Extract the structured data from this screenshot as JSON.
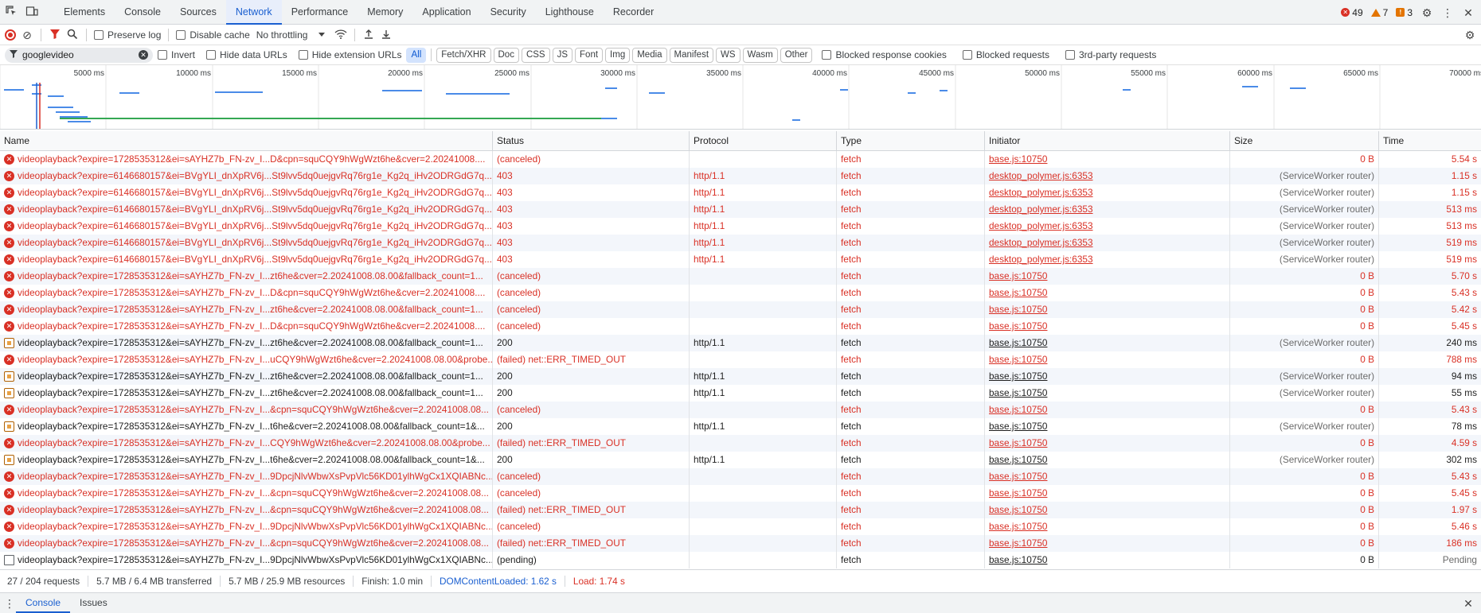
{
  "tabbar": {
    "tabs": [
      {
        "label": "Elements",
        "active": false
      },
      {
        "label": "Console",
        "active": false
      },
      {
        "label": "Sources",
        "active": false
      },
      {
        "label": "Network",
        "active": true
      },
      {
        "label": "Performance",
        "active": false
      },
      {
        "label": "Memory",
        "active": false
      },
      {
        "label": "Application",
        "active": false
      },
      {
        "label": "Security",
        "active": false
      },
      {
        "label": "Lighthouse",
        "active": false
      },
      {
        "label": "Recorder",
        "active": false
      }
    ],
    "errors": "49",
    "warnings": "7",
    "issues": "3"
  },
  "toolbar": {
    "preserve_log": "Preserve log",
    "disable_cache": "Disable cache",
    "throttling": "No throttling"
  },
  "filter": {
    "value": "googlevideo",
    "invert": "Invert",
    "hide_data_urls": "Hide data URLs",
    "hide_extension_urls": "Hide extension URLs",
    "types": [
      "All",
      "Fetch/XHR",
      "Doc",
      "CSS",
      "JS",
      "Font",
      "Img",
      "Media",
      "Manifest",
      "WS",
      "Wasm",
      "Other"
    ],
    "active_type": "All",
    "blocked_cookies": "Blocked response cookies",
    "blocked_requests": "Blocked requests",
    "third_party": "3rd-party requests"
  },
  "overview": {
    "ticks": [
      "5000 ms",
      "10000 ms",
      "15000 ms",
      "20000 ms",
      "25000 ms",
      "30000 ms",
      "35000 ms",
      "40000 ms",
      "45000 ms",
      "50000 ms",
      "55000 ms",
      "60000 ms",
      "65000 ms",
      "70000 ms"
    ],
    "colors": {
      "bar": "#4a8be8",
      "green": "#34a853",
      "domcontent": "#1a5fd0",
      "load": "#d93025"
    }
  },
  "table": {
    "headers": {
      "name": "Name",
      "status": "Status",
      "protocol": "Protocol",
      "type": "Type",
      "initiator": "Initiator",
      "size": "Size",
      "time": "Time"
    },
    "rows": [
      {
        "kind": "err",
        "name": "videoplayback?expire=1728535312&ei=sAYHZ7b_FN-zv_I...D&cpn=squCQY9hWgWzt6he&cver=2.20241008....",
        "status": "(canceled)",
        "protocol": "",
        "type": "fetch",
        "initiator": "base.js:10750",
        "size": "0 B",
        "time": "5.54 s"
      },
      {
        "kind": "err",
        "name": "videoplayback?expire=6146680157&ei=BVgYLI_dnXpRV6j...St9lvv5dq0uejgvRq76rg1e_Kg2q_iHv2ODRGdG7q...",
        "status": "403",
        "protocol": "http/1.1",
        "type": "fetch",
        "initiator": "desktop_polymer.js:6353",
        "size": "(ServiceWorker router)",
        "time": "1.15 s"
      },
      {
        "kind": "err",
        "name": "videoplayback?expire=6146680157&ei=BVgYLI_dnXpRV6j...St9lvv5dq0uejgvRq76rg1e_Kg2q_iHv2ODRGdG7q...",
        "status": "403",
        "protocol": "http/1.1",
        "type": "fetch",
        "initiator": "desktop_polymer.js:6353",
        "size": "(ServiceWorker router)",
        "time": "1.15 s"
      },
      {
        "kind": "err",
        "name": "videoplayback?expire=6146680157&ei=BVgYLI_dnXpRV6j...St9lvv5dq0uejgvRq76rg1e_Kg2q_iHv2ODRGdG7q...",
        "status": "403",
        "protocol": "http/1.1",
        "type": "fetch",
        "initiator": "desktop_polymer.js:6353",
        "size": "(ServiceWorker router)",
        "time": "513 ms"
      },
      {
        "kind": "err",
        "name": "videoplayback?expire=6146680157&ei=BVgYLI_dnXpRV6j...St9lvv5dq0uejgvRq76rg1e_Kg2q_iHv2ODRGdG7q...",
        "status": "403",
        "protocol": "http/1.1",
        "type": "fetch",
        "initiator": "desktop_polymer.js:6353",
        "size": "(ServiceWorker router)",
        "time": "513 ms"
      },
      {
        "kind": "err",
        "name": "videoplayback?expire=6146680157&ei=BVgYLI_dnXpRV6j...St9lvv5dq0uejgvRq76rg1e_Kg2q_iHv2ODRGdG7q...",
        "status": "403",
        "protocol": "http/1.1",
        "type": "fetch",
        "initiator": "desktop_polymer.js:6353",
        "size": "(ServiceWorker router)",
        "time": "519 ms"
      },
      {
        "kind": "err",
        "name": "videoplayback?expire=6146680157&ei=BVgYLI_dnXpRV6j...St9lvv5dq0uejgvRq76rg1e_Kg2q_iHv2ODRGdG7q...",
        "status": "403",
        "protocol": "http/1.1",
        "type": "fetch",
        "initiator": "desktop_polymer.js:6353",
        "size": "(ServiceWorker router)",
        "time": "519 ms"
      },
      {
        "kind": "err",
        "name": "videoplayback?expire=1728535312&ei=sAYHZ7b_FN-zv_I...zt6he&cver=2.20241008.08.00&fallback_count=1...",
        "status": "(canceled)",
        "protocol": "",
        "type": "fetch",
        "initiator": "base.js:10750",
        "size": "0 B",
        "time": "5.70 s"
      },
      {
        "kind": "err",
        "name": "videoplayback?expire=1728535312&ei=sAYHZ7b_FN-zv_I...D&cpn=squCQY9hWgWzt6he&cver=2.20241008....",
        "status": "(canceled)",
        "protocol": "",
        "type": "fetch",
        "initiator": "base.js:10750",
        "size": "0 B",
        "time": "5.43 s"
      },
      {
        "kind": "err",
        "name": "videoplayback?expire=1728535312&ei=sAYHZ7b_FN-zv_I...zt6he&cver=2.20241008.08.00&fallback_count=1...",
        "status": "(canceled)",
        "protocol": "",
        "type": "fetch",
        "initiator": "base.js:10750",
        "size": "0 B",
        "time": "5.42 s"
      },
      {
        "kind": "err",
        "name": "videoplayback?expire=1728535312&ei=sAYHZ7b_FN-zv_I...D&cpn=squCQY9hWgWzt6he&cver=2.20241008....",
        "status": "(canceled)",
        "protocol": "",
        "type": "fetch",
        "initiator": "base.js:10750",
        "size": "0 B",
        "time": "5.45 s"
      },
      {
        "kind": "ok",
        "name": "videoplayback?expire=1728535312&ei=sAYHZ7b_FN-zv_I...zt6he&cver=2.20241008.08.00&fallback_count=1...",
        "status": "200",
        "protocol": "http/1.1",
        "type": "fetch",
        "initiator": "base.js:10750",
        "size": "(ServiceWorker router)",
        "time": "240 ms"
      },
      {
        "kind": "err",
        "name": "videoplayback?expire=1728535312&ei=sAYHZ7b_FN-zv_I...uCQY9hWgWzt6he&cver=2.20241008.08.00&probe...",
        "status": "(failed) net::ERR_TIMED_OUT",
        "protocol": "",
        "type": "fetch",
        "initiator": "base.js:10750",
        "size": "0 B",
        "time": "788 ms"
      },
      {
        "kind": "ok",
        "name": "videoplayback?expire=1728535312&ei=sAYHZ7b_FN-zv_I...zt6he&cver=2.20241008.08.00&fallback_count=1...",
        "status": "200",
        "protocol": "http/1.1",
        "type": "fetch",
        "initiator": "base.js:10750",
        "size": "(ServiceWorker router)",
        "time": "94 ms"
      },
      {
        "kind": "ok",
        "name": "videoplayback?expire=1728535312&ei=sAYHZ7b_FN-zv_I...zt6he&cver=2.20241008.08.00&fallback_count=1...",
        "status": "200",
        "protocol": "http/1.1",
        "type": "fetch",
        "initiator": "base.js:10750",
        "size": "(ServiceWorker router)",
        "time": "55 ms"
      },
      {
        "kind": "err",
        "name": "videoplayback?expire=1728535312&ei=sAYHZ7b_FN-zv_I...&cpn=squCQY9hWgWzt6he&cver=2.20241008.08...",
        "status": "(canceled)",
        "protocol": "",
        "type": "fetch",
        "initiator": "base.js:10750",
        "size": "0 B",
        "time": "5.43 s"
      },
      {
        "kind": "ok",
        "name": "videoplayback?expire=1728535312&ei=sAYHZ7b_FN-zv_I...t6he&cver=2.20241008.08.00&fallback_count=1&...",
        "status": "200",
        "protocol": "http/1.1",
        "type": "fetch",
        "initiator": "base.js:10750",
        "size": "(ServiceWorker router)",
        "time": "78 ms"
      },
      {
        "kind": "err",
        "name": "videoplayback?expire=1728535312&ei=sAYHZ7b_FN-zv_I...CQY9hWgWzt6he&cver=2.20241008.08.00&probe...",
        "status": "(failed) net::ERR_TIMED_OUT",
        "protocol": "",
        "type": "fetch",
        "initiator": "base.js:10750",
        "size": "0 B",
        "time": "4.59 s"
      },
      {
        "kind": "ok",
        "name": "videoplayback?expire=1728535312&ei=sAYHZ7b_FN-zv_I...t6he&cver=2.20241008.08.00&fallback_count=1&...",
        "status": "200",
        "protocol": "http/1.1",
        "type": "fetch",
        "initiator": "base.js:10750",
        "size": "(ServiceWorker router)",
        "time": "302 ms"
      },
      {
        "kind": "err",
        "name": "videoplayback?expire=1728535312&ei=sAYHZ7b_FN-zv_I...9DpcjNlvWbwXsPvpVlc56KD01ylhWgCx1XQIABNc...",
        "status": "(canceled)",
        "protocol": "",
        "type": "fetch",
        "initiator": "base.js:10750",
        "size": "0 B",
        "time": "5.43 s"
      },
      {
        "kind": "err",
        "name": "videoplayback?expire=1728535312&ei=sAYHZ7b_FN-zv_I...&cpn=squCQY9hWgWzt6he&cver=2.20241008.08...",
        "status": "(canceled)",
        "protocol": "",
        "type": "fetch",
        "initiator": "base.js:10750",
        "size": "0 B",
        "time": "5.45 s"
      },
      {
        "kind": "err",
        "name": "videoplayback?expire=1728535312&ei=sAYHZ7b_FN-zv_I...&cpn=squCQY9hWgWzt6he&cver=2.20241008.08...",
        "status": "(failed) net::ERR_TIMED_OUT",
        "protocol": "",
        "type": "fetch",
        "initiator": "base.js:10750",
        "size": "0 B",
        "time": "1.97 s"
      },
      {
        "kind": "err",
        "name": "videoplayback?expire=1728535312&ei=sAYHZ7b_FN-zv_I...9DpcjNlvWbwXsPvpVlc56KD01ylhWgCx1XQIABNc...",
        "status": "(canceled)",
        "protocol": "",
        "type": "fetch",
        "initiator": "base.js:10750",
        "size": "0 B",
        "time": "5.46 s"
      },
      {
        "kind": "err",
        "name": "videoplayback?expire=1728535312&ei=sAYHZ7b_FN-zv_I...&cpn=squCQY9hWgWzt6he&cver=2.20241008.08...",
        "status": "(failed) net::ERR_TIMED_OUT",
        "protocol": "",
        "type": "fetch",
        "initiator": "base.js:10750",
        "size": "0 B",
        "time": "186 ms"
      },
      {
        "kind": "pending",
        "name": "videoplayback?expire=1728535312&ei=sAYHZ7b_FN-zv_I...9DpcjNlvWbwXsPvpVlc56KD01ylhWgCx1XQIABNc...",
        "status": "(pending)",
        "protocol": "",
        "type": "fetch",
        "initiator": "base.js:10750",
        "size": "0 B",
        "time": "Pending"
      }
    ]
  },
  "statusbar": {
    "requests": "27 / 204 requests",
    "transferred": "5.7 MB / 6.4 MB transferred",
    "resources": "5.7 MB / 25.9 MB resources",
    "finish": "Finish: 1.0 min",
    "domcontentloaded": "DOMContentLoaded: 1.62 s",
    "load": "Load: 1.74 s"
  },
  "drawer": {
    "tabs": [
      {
        "label": "Console",
        "active": true
      },
      {
        "label": "Issues",
        "active": false
      }
    ]
  }
}
